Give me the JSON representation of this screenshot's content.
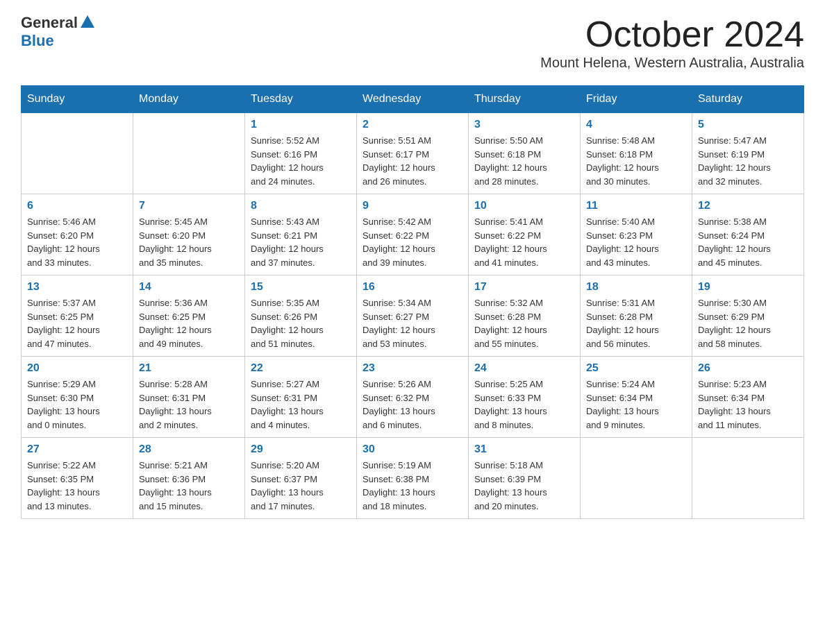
{
  "header": {
    "logo_general": "General",
    "logo_blue": "Blue",
    "month_title": "October 2024",
    "location": "Mount Helena, Western Australia, Australia"
  },
  "weekdays": [
    "Sunday",
    "Monday",
    "Tuesday",
    "Wednesday",
    "Thursday",
    "Friday",
    "Saturday"
  ],
  "weeks": [
    [
      {
        "day": "",
        "info": ""
      },
      {
        "day": "",
        "info": ""
      },
      {
        "day": "1",
        "info": "Sunrise: 5:52 AM\nSunset: 6:16 PM\nDaylight: 12 hours\nand 24 minutes."
      },
      {
        "day": "2",
        "info": "Sunrise: 5:51 AM\nSunset: 6:17 PM\nDaylight: 12 hours\nand 26 minutes."
      },
      {
        "day": "3",
        "info": "Sunrise: 5:50 AM\nSunset: 6:18 PM\nDaylight: 12 hours\nand 28 minutes."
      },
      {
        "day": "4",
        "info": "Sunrise: 5:48 AM\nSunset: 6:18 PM\nDaylight: 12 hours\nand 30 minutes."
      },
      {
        "day": "5",
        "info": "Sunrise: 5:47 AM\nSunset: 6:19 PM\nDaylight: 12 hours\nand 32 minutes."
      }
    ],
    [
      {
        "day": "6",
        "info": "Sunrise: 5:46 AM\nSunset: 6:20 PM\nDaylight: 12 hours\nand 33 minutes."
      },
      {
        "day": "7",
        "info": "Sunrise: 5:45 AM\nSunset: 6:20 PM\nDaylight: 12 hours\nand 35 minutes."
      },
      {
        "day": "8",
        "info": "Sunrise: 5:43 AM\nSunset: 6:21 PM\nDaylight: 12 hours\nand 37 minutes."
      },
      {
        "day": "9",
        "info": "Sunrise: 5:42 AM\nSunset: 6:22 PM\nDaylight: 12 hours\nand 39 minutes."
      },
      {
        "day": "10",
        "info": "Sunrise: 5:41 AM\nSunset: 6:22 PM\nDaylight: 12 hours\nand 41 minutes."
      },
      {
        "day": "11",
        "info": "Sunrise: 5:40 AM\nSunset: 6:23 PM\nDaylight: 12 hours\nand 43 minutes."
      },
      {
        "day": "12",
        "info": "Sunrise: 5:38 AM\nSunset: 6:24 PM\nDaylight: 12 hours\nand 45 minutes."
      }
    ],
    [
      {
        "day": "13",
        "info": "Sunrise: 5:37 AM\nSunset: 6:25 PM\nDaylight: 12 hours\nand 47 minutes."
      },
      {
        "day": "14",
        "info": "Sunrise: 5:36 AM\nSunset: 6:25 PM\nDaylight: 12 hours\nand 49 minutes."
      },
      {
        "day": "15",
        "info": "Sunrise: 5:35 AM\nSunset: 6:26 PM\nDaylight: 12 hours\nand 51 minutes."
      },
      {
        "day": "16",
        "info": "Sunrise: 5:34 AM\nSunset: 6:27 PM\nDaylight: 12 hours\nand 53 minutes."
      },
      {
        "day": "17",
        "info": "Sunrise: 5:32 AM\nSunset: 6:28 PM\nDaylight: 12 hours\nand 55 minutes."
      },
      {
        "day": "18",
        "info": "Sunrise: 5:31 AM\nSunset: 6:28 PM\nDaylight: 12 hours\nand 56 minutes."
      },
      {
        "day": "19",
        "info": "Sunrise: 5:30 AM\nSunset: 6:29 PM\nDaylight: 12 hours\nand 58 minutes."
      }
    ],
    [
      {
        "day": "20",
        "info": "Sunrise: 5:29 AM\nSunset: 6:30 PM\nDaylight: 13 hours\nand 0 minutes."
      },
      {
        "day": "21",
        "info": "Sunrise: 5:28 AM\nSunset: 6:31 PM\nDaylight: 13 hours\nand 2 minutes."
      },
      {
        "day": "22",
        "info": "Sunrise: 5:27 AM\nSunset: 6:31 PM\nDaylight: 13 hours\nand 4 minutes."
      },
      {
        "day": "23",
        "info": "Sunrise: 5:26 AM\nSunset: 6:32 PM\nDaylight: 13 hours\nand 6 minutes."
      },
      {
        "day": "24",
        "info": "Sunrise: 5:25 AM\nSunset: 6:33 PM\nDaylight: 13 hours\nand 8 minutes."
      },
      {
        "day": "25",
        "info": "Sunrise: 5:24 AM\nSunset: 6:34 PM\nDaylight: 13 hours\nand 9 minutes."
      },
      {
        "day": "26",
        "info": "Sunrise: 5:23 AM\nSunset: 6:34 PM\nDaylight: 13 hours\nand 11 minutes."
      }
    ],
    [
      {
        "day": "27",
        "info": "Sunrise: 5:22 AM\nSunset: 6:35 PM\nDaylight: 13 hours\nand 13 minutes."
      },
      {
        "day": "28",
        "info": "Sunrise: 5:21 AM\nSunset: 6:36 PM\nDaylight: 13 hours\nand 15 minutes."
      },
      {
        "day": "29",
        "info": "Sunrise: 5:20 AM\nSunset: 6:37 PM\nDaylight: 13 hours\nand 17 minutes."
      },
      {
        "day": "30",
        "info": "Sunrise: 5:19 AM\nSunset: 6:38 PM\nDaylight: 13 hours\nand 18 minutes."
      },
      {
        "day": "31",
        "info": "Sunrise: 5:18 AM\nSunset: 6:39 PM\nDaylight: 13 hours\nand 20 minutes."
      },
      {
        "day": "",
        "info": ""
      },
      {
        "day": "",
        "info": ""
      }
    ]
  ]
}
